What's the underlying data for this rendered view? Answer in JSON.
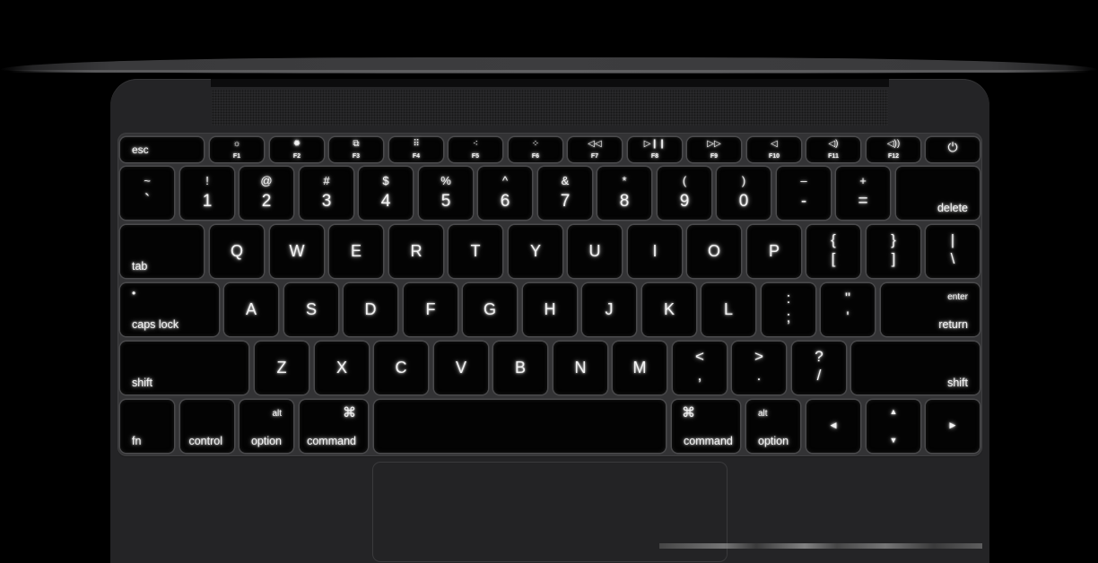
{
  "scene": {
    "description": "Top-down view of a backlit laptop keyboard",
    "colors": {
      "background": "#000000",
      "body": "#242426",
      "key": "#030303",
      "key_border": "#4a4a4c",
      "legend": "#f2f2f2"
    }
  },
  "keyboard": {
    "function_row": [
      {
        "id": "esc",
        "label": "esc"
      },
      {
        "id": "f1",
        "glyph": "☼",
        "label": "F1",
        "icon": "brightness-down-icon"
      },
      {
        "id": "f2",
        "glyph": "✹",
        "label": "F2",
        "icon": "brightness-up-icon"
      },
      {
        "id": "f3",
        "glyph": "⧉",
        "label": "F3",
        "icon": "mission-control-icon"
      },
      {
        "id": "f4",
        "glyph": "⠿",
        "label": "F4",
        "icon": "launchpad-icon"
      },
      {
        "id": "f5",
        "glyph": "⁖",
        "label": "F5",
        "icon": "keyboard-backlight-down-icon"
      },
      {
        "id": "f6",
        "glyph": "⁘",
        "label": "F6",
        "icon": "keyboard-backlight-up-icon"
      },
      {
        "id": "f7",
        "glyph": "◁◁",
        "label": "F7",
        "icon": "rewind-icon"
      },
      {
        "id": "f8",
        "glyph": "▷❙❙",
        "label": "F8",
        "icon": "play-pause-icon"
      },
      {
        "id": "f9",
        "glyph": "▷▷",
        "label": "F9",
        "icon": "fast-forward-icon"
      },
      {
        "id": "f10",
        "glyph": "◁",
        "label": "F10",
        "icon": "mute-icon"
      },
      {
        "id": "f11",
        "glyph": "◁)",
        "label": "F11",
        "icon": "volume-down-icon"
      },
      {
        "id": "f12",
        "glyph": "◁))",
        "label": "F12",
        "icon": "volume-up-icon"
      },
      {
        "id": "power",
        "glyph": "⏻",
        "icon": "power-icon"
      }
    ],
    "number_row": [
      {
        "top": "~",
        "bottom": "`"
      },
      {
        "top": "!",
        "bottom": "1"
      },
      {
        "top": "@",
        "bottom": "2"
      },
      {
        "top": "#",
        "bottom": "3"
      },
      {
        "top": "$",
        "bottom": "4"
      },
      {
        "top": "%",
        "bottom": "5"
      },
      {
        "top": "^",
        "bottom": "6"
      },
      {
        "top": "&",
        "bottom": "7"
      },
      {
        "top": "*",
        "bottom": "8"
      },
      {
        "top": "(",
        "bottom": "9"
      },
      {
        "top": ")",
        "bottom": "0"
      },
      {
        "top": "–",
        "bottom": "-"
      },
      {
        "top": "+",
        "bottom": "="
      }
    ],
    "delete": "delete",
    "tab": "tab",
    "qwerty": [
      "Q",
      "W",
      "E",
      "R",
      "T",
      "Y",
      "U",
      "I",
      "O",
      "P"
    ],
    "brackets": [
      {
        "top": "{",
        "bottom": "["
      },
      {
        "top": "}",
        "bottom": "]"
      },
      {
        "top": "|",
        "bottom": "\\"
      }
    ],
    "caps_lock": "caps lock",
    "caps_indicator": "•",
    "home_row": [
      "A",
      "S",
      "D",
      "F",
      "G",
      "H",
      "J",
      "K",
      "L"
    ],
    "home_punct": [
      {
        "top": ":",
        "bottom": ";"
      },
      {
        "top": "\"",
        "bottom": "'"
      }
    ],
    "enter": "enter",
    "return": "return",
    "shift_left": "shift",
    "bottom_letters": [
      "Z",
      "X",
      "C",
      "V",
      "B",
      "N",
      "M"
    ],
    "bottom_punct": [
      {
        "top": "<",
        "bottom": ","
      },
      {
        "top": ">",
        "bottom": "."
      },
      {
        "top": "?",
        "bottom": "/"
      }
    ],
    "shift_right": "shift",
    "modifier_row": {
      "fn": "fn",
      "control": "control",
      "option_left": {
        "alt": "alt",
        "label": "option"
      },
      "command_left": {
        "symbol": "⌘",
        "label": "command"
      },
      "command_right": {
        "symbol": "⌘",
        "label": "command"
      },
      "option_right": {
        "alt": "alt",
        "label": "option"
      },
      "arrows": {
        "left": "◀",
        "up": "▲",
        "down": "▼",
        "right": "▶"
      }
    }
  }
}
